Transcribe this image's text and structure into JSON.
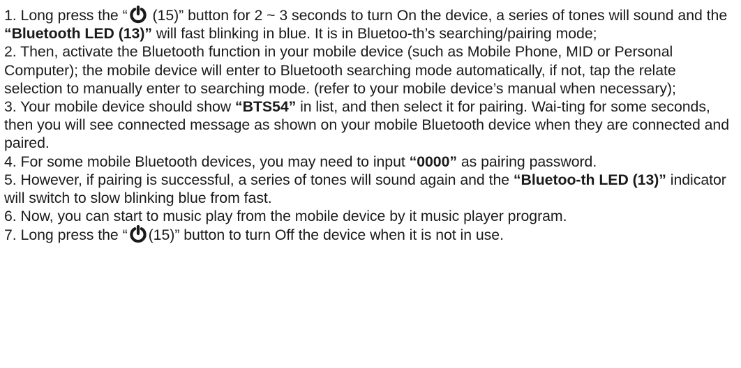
{
  "instructions": {
    "step1": {
      "prefix": "1. Long press the “",
      "icon": "power-icon",
      "mid": " (15)” button for 2 ~ 3 seconds to turn On the device, a series of tones will sound and the ",
      "bold": "“Bluetooth LED (13)”",
      "suffix": " will fast blinking in blue. It is in Bluetoo-th’s searching/pairing mode;"
    },
    "step2": {
      "text": "2. Then, activate the Bluetooth function in your mobile device (such as Mobile Phone, MID or Personal Computer); the mobile device will enter to Bluetooth searching mode automatically, if not, tap the relate selection to manually enter to searching mode. (refer to your mobile device’s manual when necessary);"
    },
    "step3": {
      "prefix": "3. Your mobile device should show ",
      "bold": "“BTS54”",
      "suffix": " in list, and then select it for pairing. Wai-ting for some seconds, then you will see connected message as shown on your mobile Bluetooth device when they are connected and paired."
    },
    "step4": {
      "prefix": "4. For some mobile Bluetooth devices, you may need to input ",
      "bold": "“0000”",
      "suffix": " as pairing password."
    },
    "step5": {
      "prefix": "5. However, if pairing is successful, a series of tones will sound again and the ",
      "bold": "“Bluetoo-th LED (13)”",
      "suffix": " indicator will switch to slow blinking blue from fast."
    },
    "step6": {
      "text": "6. Now, you can start to music play from the mobile device by it music player program."
    },
    "step7": {
      "prefix": "7. Long press the “",
      "icon": "power-icon",
      "suffix": "(15)” button to turn Off the device when it is not in use."
    }
  }
}
